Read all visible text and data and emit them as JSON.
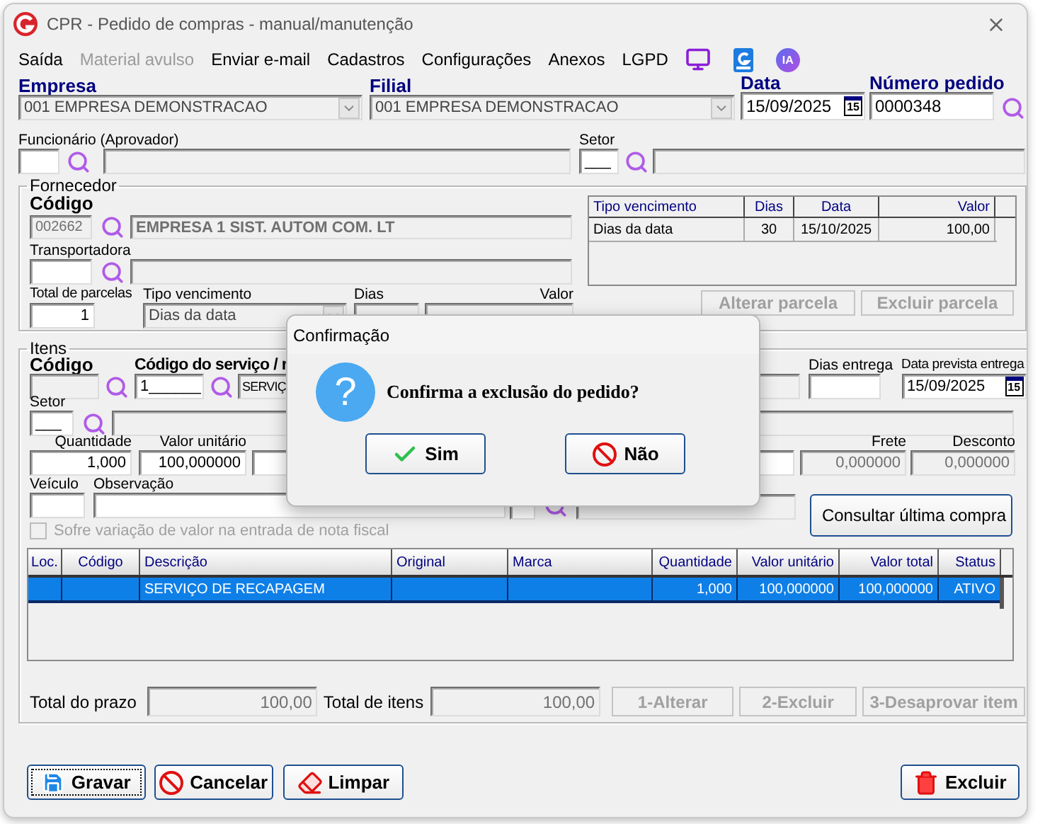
{
  "window": {
    "title": "CPR - Pedido de compras - manual/manutenção"
  },
  "menu": [
    {
      "label": "Saída",
      "disabled": false
    },
    {
      "label": "Material avulso",
      "disabled": true
    },
    {
      "label": "Enviar e-mail",
      "disabled": false
    },
    {
      "label": "Cadastros",
      "disabled": false
    },
    {
      "label": "Configurações",
      "disabled": false
    },
    {
      "label": "Anexos",
      "disabled": false
    },
    {
      "label": "LGPD",
      "disabled": false
    }
  ],
  "ia_badge": "IA",
  "header": {
    "empresa": {
      "label": "Empresa",
      "value": "001 EMPRESA DEMONSTRACAO"
    },
    "filial": {
      "label": "Filial",
      "value": "001 EMPRESA DEMONSTRACAO"
    },
    "data": {
      "label": "Data",
      "value": "15/09/2025",
      "calendar": "15"
    },
    "numero_pedido": {
      "label": "Número pedido",
      "value": "0000348"
    }
  },
  "funcionario": {
    "label": "Funcionário (Aprovador)"
  },
  "setor": {
    "label": "Setor",
    "value": "___"
  },
  "fornecedor": {
    "title": "Fornecedor",
    "codigo_label": "Código",
    "codigo": "002662",
    "nome": "EMPRESA 1 SIST. AUTOM COM. LT",
    "transportadora_label": "Transportadora",
    "total_parcelas_label": "Total de parcelas",
    "total_parcelas": "1",
    "tipo_vencimento_label": "Tipo vencimento",
    "tipo_vencimento": "Dias da data",
    "dias_label": "Dias",
    "valor_label": "Valor",
    "parcelas": {
      "columns": [
        "Tipo vencimento",
        "Dias",
        "Data",
        "Valor"
      ],
      "rows": [
        [
          "Dias da data",
          "30",
          "15/10/2025",
          "100,00"
        ]
      ]
    },
    "buttons": [
      {
        "label": "Alterar parcela",
        "disabled": true
      },
      {
        "label": "Excluir parcela",
        "disabled": true
      }
    ]
  },
  "itens": {
    "title": "Itens",
    "codigo_label": "Código",
    "servico_label": "Código do serviço / r",
    "servico_codigo": "1______",
    "servico_nome": "SERVIÇ",
    "dias_entrega_label": "Dias entrega",
    "data_prevista_label": "Data prevista entrega",
    "data_prevista": "15/09/2025",
    "calendar": "15",
    "setor_label": "Setor",
    "setor": "___",
    "quantidade_label": "Quantidade",
    "quantidade": "1,000",
    "valor_unitario_label": "Valor unitário",
    "valor_unitario": "100,000000",
    "frete_label": "Frete",
    "frete": "0,000000",
    "desconto_label": "Desconto",
    "desconto": "0,000000",
    "veiculo_label": "Veículo",
    "observacao_label": "Observação",
    "consultar_button": "Consultar última compra",
    "variacao": {
      "label": "Sofre variação de valor na entrada de nota fiscal",
      "checked": false,
      "disabled": true
    },
    "table": {
      "columns": [
        "Loc.",
        "Código",
        "Descrição",
        "Original",
        "Marca",
        "Quantidade",
        "Valor unitário",
        "Valor total",
        "Status"
      ],
      "rows": [
        {
          "cells": [
            "",
            "",
            "SERVIÇO DE RECAPAGEM",
            "",
            "",
            "1,000",
            "100,000000",
            "100,000000",
            "ATIVO"
          ],
          "selected": true
        }
      ]
    },
    "total_prazo_label": "Total do prazo",
    "total_prazo": "100,00",
    "total_itens_label": "Total de itens",
    "total_itens": "100,00",
    "buttons": [
      {
        "label": "1-Alterar",
        "disabled": true
      },
      {
        "label": "2-Excluir",
        "disabled": true
      },
      {
        "label": "3-Desaprovar item",
        "disabled": true
      }
    ]
  },
  "dialog": {
    "title": "Confirmação",
    "icon_glyph": "?",
    "message": "Confirma a exclusão do pedido?",
    "buttons": [
      {
        "label": "Sim",
        "kind": "confirm"
      },
      {
        "label": "Não",
        "kind": "cancel"
      }
    ]
  },
  "footer_buttons": [
    {
      "label": "Gravar",
      "kind": "save"
    },
    {
      "label": "Cancelar",
      "kind": "cancel"
    },
    {
      "label": "Limpar",
      "kind": "clear"
    },
    {
      "label": "Excluir",
      "kind": "delete"
    }
  ]
}
